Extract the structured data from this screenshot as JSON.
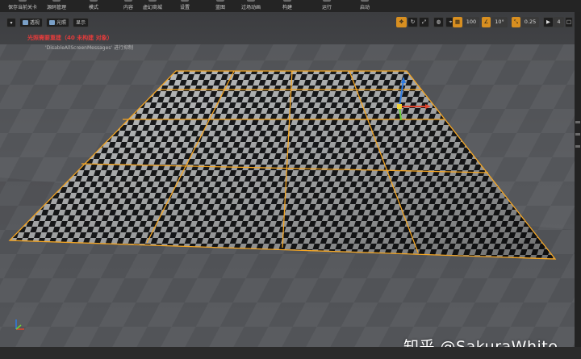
{
  "toolbar": {
    "items": [
      {
        "label": "保存当前关卡"
      },
      {
        "label": "源码管理"
      },
      {
        "label": "模式"
      },
      {
        "label": "内容"
      },
      {
        "label": "虚幻商城"
      },
      {
        "label": "设置"
      },
      {
        "label": "蓝图"
      },
      {
        "label": "过场动画"
      },
      {
        "label": "构建"
      },
      {
        "label": "运行"
      },
      {
        "label": "启动"
      }
    ]
  },
  "viewport": {
    "dropdown_icon": "chevron-down-icon",
    "buttons": [
      {
        "label": "透视",
        "icon": "perspective-icon"
      },
      {
        "label": "光照",
        "icon": "lit-sphere-icon"
      },
      {
        "label": "显示"
      }
    ],
    "warning": "光照需要重建（40 未构建 对象）",
    "sub_warning": "'DisableAllScreenMessages' 进行抑制"
  },
  "viewport_toolbar": {
    "grid_snap_value": "100",
    "rotation_snap_value": "10°",
    "scale_snap_value": "0.25",
    "camera_speed": "4"
  },
  "watermark": "知乎 @SakuraWhite",
  "colors": {
    "accent_orange": "#f5a623",
    "warning_red": "#e23c3c",
    "gizmo_x": "#e0452e",
    "gizmo_y": "#6bd23a",
    "gizmo_z": "#2e7ae0"
  }
}
